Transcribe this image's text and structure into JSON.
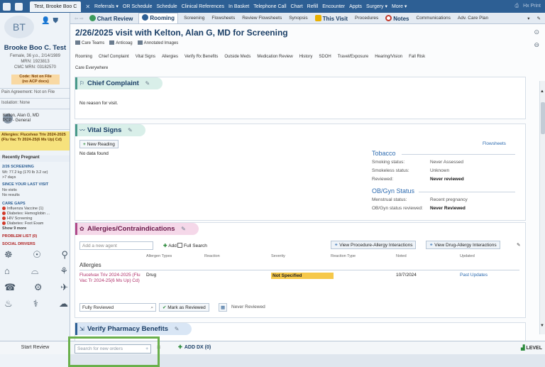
{
  "topbar": {
    "patient_tab": "Test, Brooke Boo C",
    "items": [
      "Referrals ▾",
      "OR Schedule",
      "Schedule",
      "Clinical References",
      "In Basket",
      "Telephone Call",
      "Chart",
      "Refill",
      "Encounter",
      "Appts",
      "Surgery ▾",
      "More ▾"
    ],
    "right": "Hx Print"
  },
  "sidebar": {
    "initials": "BT",
    "name": "Brooke Boo C. Test",
    "demo": "Female, 36 y.o., 2/14/1989",
    "mrn": "MRN: 1923813",
    "cmc": "CMC MRN: 03182570",
    "code": "Code: Not on File",
    "code2": "(no ACP docs)",
    "pain": "Pain Agreement: Not on File",
    "isolation": "Isolation: None",
    "pcp_name": "Kelton, Alan G, MD",
    "pcp_role": "PCP - General",
    "allergies": "Allergies: Flucelvax Triv 2024-2025 (Flu Vac Tr 2024-25(6 Ms Up) Cd)",
    "pregnant": "Recently Pregnant",
    "screening_title": "2/26 SCREENING",
    "screening_wt": "Wt: 77.2 kg (170 lb 3.2 oz)",
    "screening_days": ">7 days",
    "since_title": "SINCE YOUR LAST VISIT",
    "since_1": "No visits",
    "since_2": "No results",
    "care_title": "CARE GAPS",
    "care_1": "Influenza Vaccine (1)",
    "care_2": "Diabetes: Hemoglobin ...",
    "care_3": "HIV Screening",
    "care_4": "Diabetes: Foot Exam",
    "care_more": "Show 9 more",
    "problem": "PROBLEM LIST (0)",
    "social": "SOCIAL DRIVERS",
    "start_review": "Start Review"
  },
  "tabs": [
    "Chart Review",
    "Rooming",
    "Screening",
    "Flowsheets",
    "Review Flowsheets",
    "Synopsis",
    "This Visit",
    "Procedures",
    "Notes",
    "Communications",
    "Adv. Care Plan"
  ],
  "visit": {
    "title": "2/26/2025 visit with Kelton, Alan G, MD for Screening",
    "tools": [
      "Care Teams",
      "Anticoag",
      "Annotated Images"
    ],
    "nav": [
      "Rooming",
      "Chief Complaint",
      "Vital Signs",
      "Allergies",
      "Verify Rx Benefits",
      "Outside Meds",
      "Medication Review",
      "History",
      "SDOH",
      "Travel/Exposure",
      "Hearing/Vision",
      "Fall Risk"
    ],
    "nav2": "Care Everywhere"
  },
  "chief": {
    "title": "Chief Complaint",
    "text": "No reason for visit."
  },
  "vitals": {
    "title": "Vital Signs",
    "new_reading": "New Reading",
    "no_data": "No data found",
    "flowsheets": "Flowsheets",
    "tobacco_title": "Tobacco",
    "smoking_label": "Smoking status:",
    "smoking_val": "Never Assessed",
    "smokeless_label": "Smokeless status:",
    "smokeless_val": "Unknown",
    "reviewed_label": "Reviewed:",
    "reviewed_val": "Never reviewed",
    "obgyn_title": "OB/Gyn Status",
    "menstrual_label": "Menstrual status:",
    "menstrual_val": "Recent pregnancy",
    "obgyn_rev_label": "OB/Gyn status reviewed:",
    "obgyn_rev_val": "Never Reviewed"
  },
  "allergies": {
    "title": "Allergies/Contraindications",
    "add_placeholder": "Add a new agent",
    "add_btn": "Add",
    "full_search": "Full Search",
    "view_proc": "View Procedure-Allergy Interactions",
    "view_drug": "View Drug-Allergy Interactions",
    "columns": [
      "Allergen Types",
      "Reaction",
      "Severity",
      "Reaction Type",
      "Noted",
      "Updated"
    ],
    "group": "Allergies",
    "agent": "Flucelvax Triv 2024-2025 (Flu Vac Tr 2024-25(6 Ms Up) Cd)",
    "type": "Drug",
    "severity": "Not Specified",
    "noted": "10/7/2024",
    "updated": "Past Updates",
    "review_status": "Fully Reviewed",
    "mark_reviewed": "Mark as Reviewed",
    "never_reviewed": "Never Reviewed"
  },
  "pharmacy": {
    "title": "Verify Pharmacy Benefits"
  },
  "bottom": {
    "order_placeholder": "Search for new orders",
    "add_dx": "ADD DX (0)",
    "level": "LEVEL"
  }
}
